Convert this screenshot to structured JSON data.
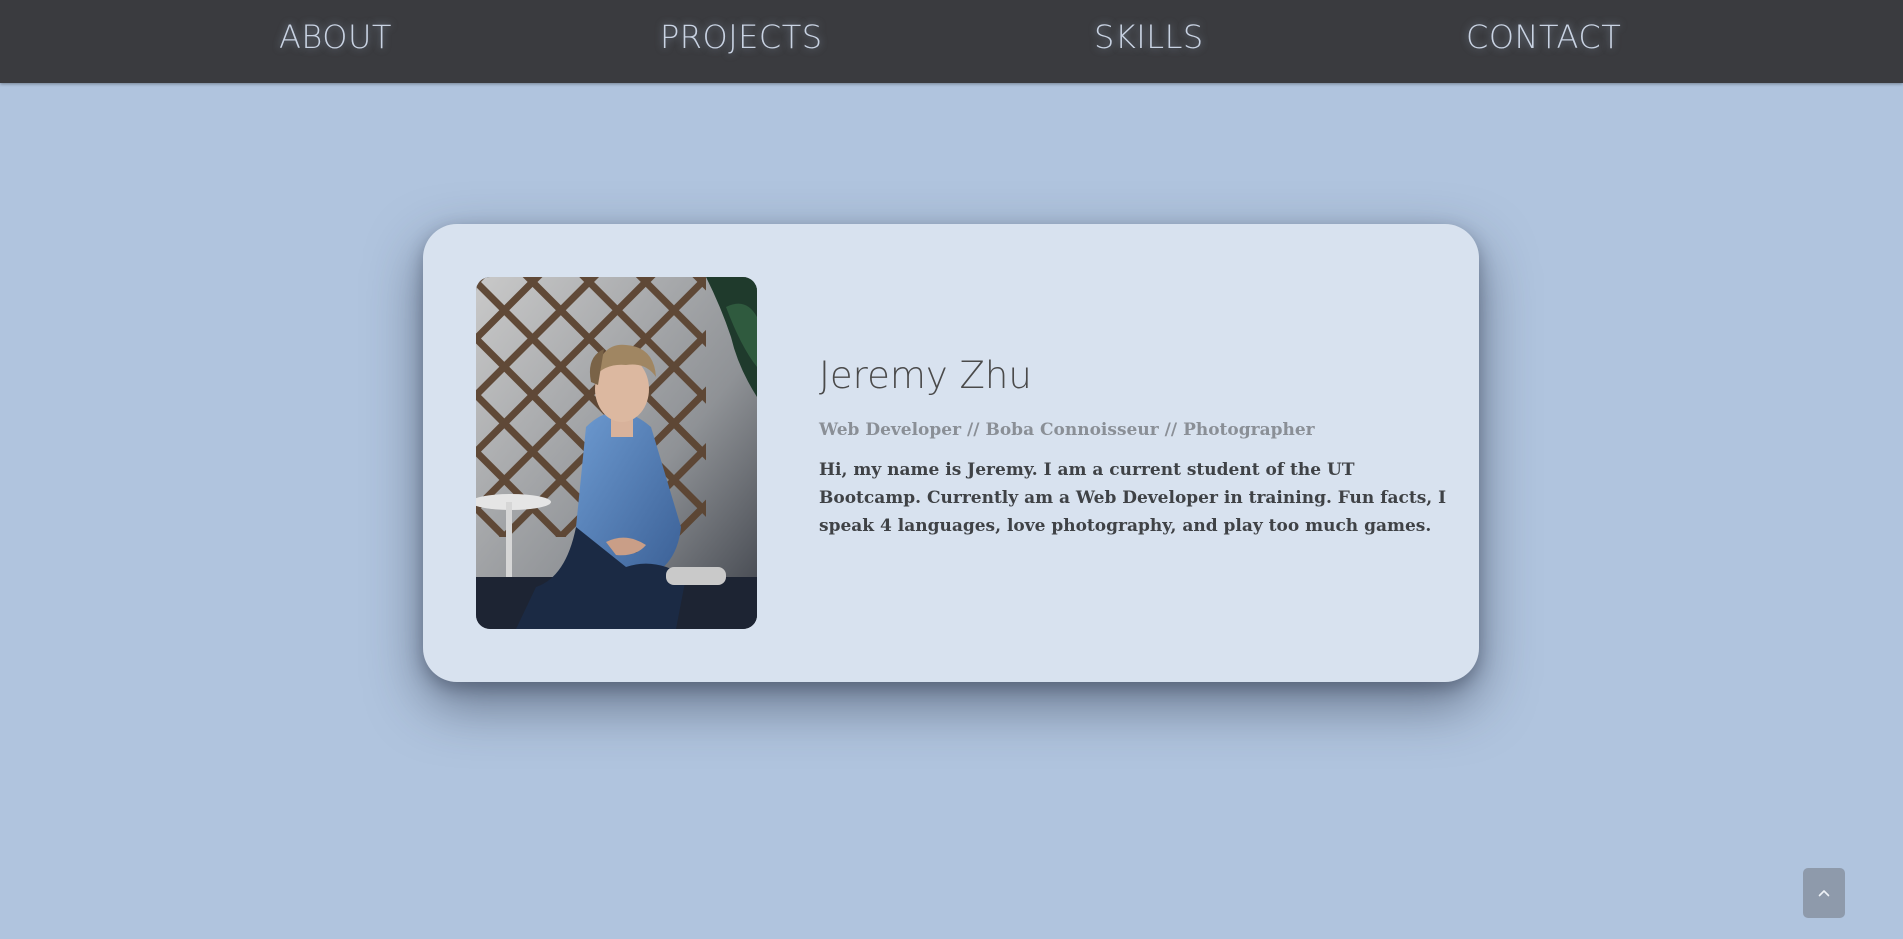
{
  "nav": {
    "items": [
      {
        "label": "ABOUT"
      },
      {
        "label": "PROJECTS"
      },
      {
        "label": "SKILLS"
      },
      {
        "label": "CONTACT"
      }
    ]
  },
  "profile": {
    "name": "Jeremy Zhu",
    "roles": [
      "Web Developer",
      "Boba Connoisseur",
      "Photographer"
    ],
    "role_separator": "//",
    "bio": "Hi, my name is Jeremy. I am a current student of the UT Bootcamp. Currently am a Web Developer in training. Fun facts, I speak 4 languages, love photography, and play too much games."
  },
  "scroll_top": {
    "icon": "chevron-up-icon"
  },
  "colors": {
    "background": "#b0c4de",
    "navbar": "#3a3b3f",
    "nav_text": "#c9d3e3",
    "card": "#d8e2ef",
    "scroll_button": "#8e9aab"
  }
}
